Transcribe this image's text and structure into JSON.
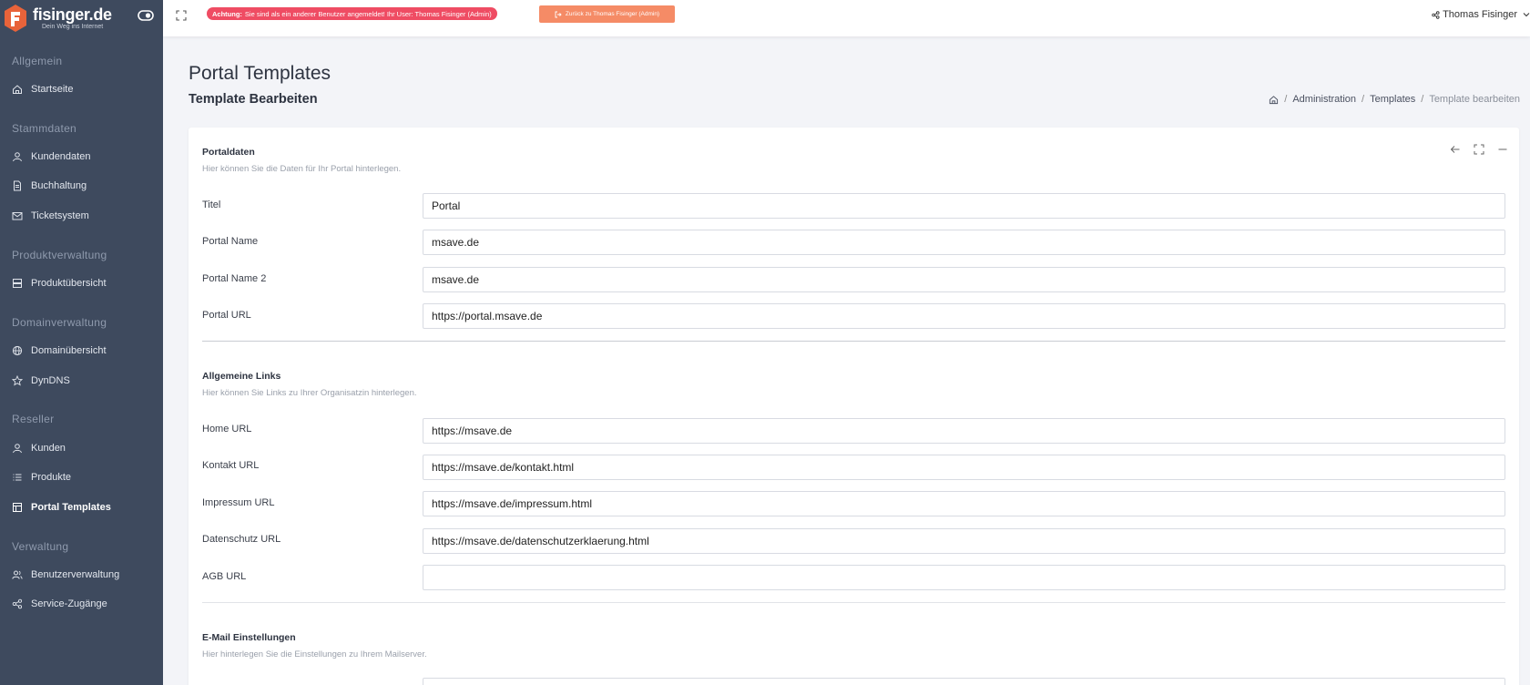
{
  "brand": {
    "name": "fisinger.de",
    "tagline": "Dein Weg ins Internet",
    "accent": "#e8633a"
  },
  "sidebar": {
    "sections": [
      {
        "label": "Allgemein",
        "items": [
          {
            "label": "Startseite",
            "icon": "home-icon"
          }
        ]
      },
      {
        "label": "Stammdaten",
        "items": [
          {
            "label": "Kundendaten",
            "icon": "user-icon"
          },
          {
            "label": "Buchhaltung",
            "icon": "document-icon"
          },
          {
            "label": "Ticketsystem",
            "icon": "mail-icon"
          }
        ]
      },
      {
        "label": "Produktverwaltung",
        "items": [
          {
            "label": "Produktübersicht",
            "icon": "server-icon"
          }
        ]
      },
      {
        "label": "Domainverwaltung",
        "items": [
          {
            "label": "Domainübersicht",
            "icon": "globe-icon"
          },
          {
            "label": "DynDNS",
            "icon": "star-icon"
          }
        ]
      },
      {
        "label": "Reseller",
        "items": [
          {
            "label": "Kunden",
            "icon": "user-icon"
          },
          {
            "label": "Produkte",
            "icon": "list-icon"
          },
          {
            "label": "Portal Templates",
            "icon": "layout-icon",
            "active": true
          }
        ]
      },
      {
        "label": "Verwaltung",
        "items": [
          {
            "label": "Benutzerverwaltung",
            "icon": "users-icon"
          },
          {
            "label": "Service-Zugänge",
            "icon": "share-icon"
          }
        ]
      }
    ]
  },
  "topbar": {
    "alert_strong": "Achtung:",
    "alert_text": "Sie sind als ein anderer Benutzer angemeldet! Ihr User: Thomas Fisinger (Admin)",
    "back_button": "Zurück zu Thomas Fisinger (Admin)",
    "user_name": "Thomas Fisinger"
  },
  "page": {
    "title": "Portal Templates",
    "subtitle": "Template Bearbeiten",
    "breadcrumb": [
      "Administration",
      "Templates",
      "Template bearbeiten"
    ]
  },
  "form": {
    "portal": {
      "title": "Portaldaten",
      "description": "Hier können Sie die Daten für Ihr Portal hinterlegen.",
      "fields": [
        {
          "label": "Titel",
          "value": "Portal"
        },
        {
          "label": "Portal Name",
          "value": "msave.de"
        },
        {
          "label": "Portal Name 2",
          "value": "msave.de"
        },
        {
          "label": "Portal URL",
          "value": "https://portal.msave.de"
        }
      ]
    },
    "links": {
      "title": "Allgemeine Links",
      "description": "Hier können Sie Links zu Ihrer Organisatzin hinterlegen.",
      "fields": [
        {
          "label": "Home URL",
          "value": "https://msave.de"
        },
        {
          "label": "Kontakt URL",
          "value": "https://msave.de/kontakt.html"
        },
        {
          "label": "Impressum URL",
          "value": "https://msave.de/impressum.html"
        },
        {
          "label": "Datenschutz URL",
          "value": "https://msave.de/datenschutzerklaerung.html"
        },
        {
          "label": "AGB URL",
          "value": ""
        }
      ]
    },
    "email": {
      "title": "E-Mail Einstellungen",
      "description": "Hier hinterlegen Sie die Einstellungen zu Ihrem Mailserver."
    }
  }
}
